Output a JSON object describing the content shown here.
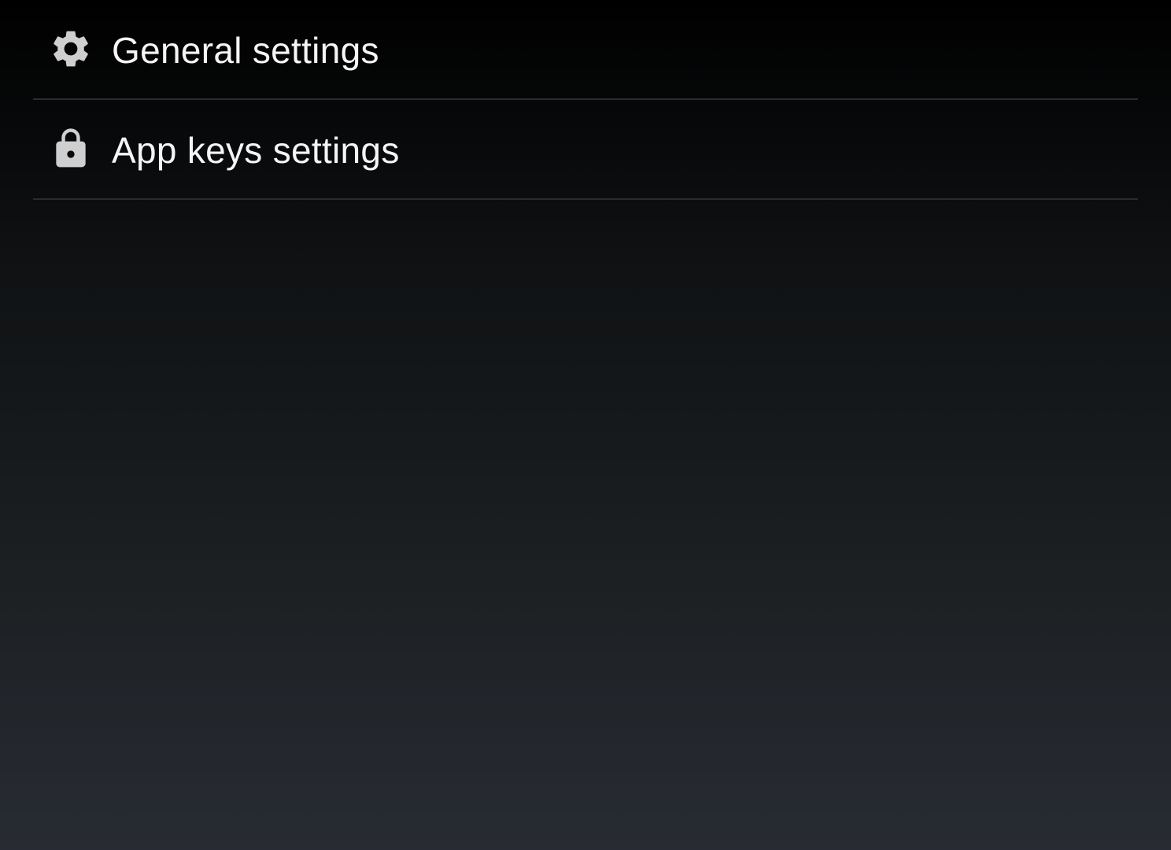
{
  "settings": {
    "items": [
      {
        "label": "General settings",
        "icon": "gear-icon"
      },
      {
        "label": "App keys settings",
        "icon": "lock-icon"
      }
    ]
  },
  "colors": {
    "icon": "#cfcfcf",
    "text": "#f5f5f5",
    "divider": "#2a2d30"
  }
}
